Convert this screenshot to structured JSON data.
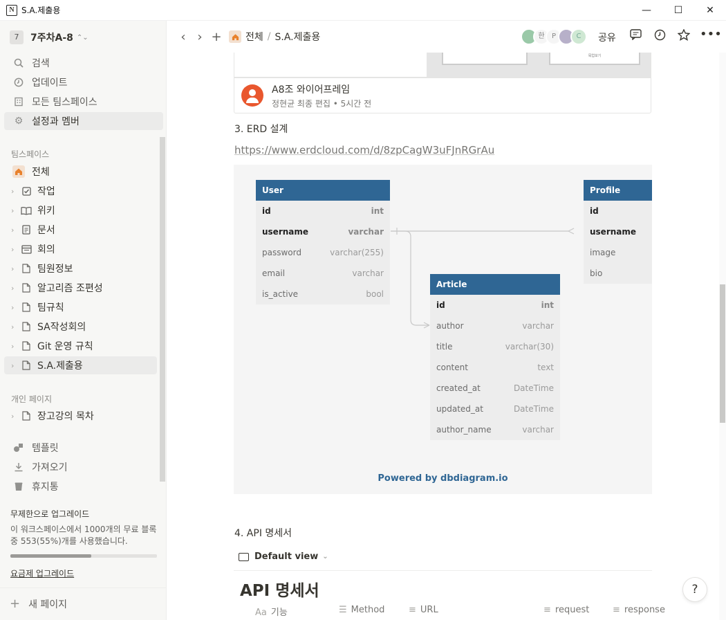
{
  "window": {
    "title": "S.A.제출용",
    "icon": "notion-icon"
  },
  "sidebar": {
    "workspace": {
      "badge": "7",
      "name": "7주차A-8"
    },
    "top_items": [
      {
        "label": "검색",
        "icon": "search-icon"
      },
      {
        "label": "업데이트",
        "icon": "clock-icon"
      },
      {
        "label": "모든 팀스페이스",
        "icon": "building-icon"
      },
      {
        "label": "설정과 멤버",
        "icon": "gear-icon"
      }
    ],
    "teamspace_header": "팀스페이스",
    "teamspace_root": "전체",
    "pages": [
      {
        "label": "작업",
        "icon": "checkbox-icon"
      },
      {
        "label": "위키",
        "icon": "book-icon"
      },
      {
        "label": "문서",
        "icon": "doc-icon"
      },
      {
        "label": "회의",
        "icon": "calendar-icon"
      },
      {
        "label": "팀원정보",
        "icon": "page-icon"
      },
      {
        "label": "알고리즘 조편성",
        "icon": "page-icon"
      },
      {
        "label": "팀규칙",
        "icon": "page-icon"
      },
      {
        "label": "SA작성회의",
        "icon": "page-icon"
      },
      {
        "label": "Git 운영 규칙",
        "icon": "page-icon"
      },
      {
        "label": "S.A.제출용",
        "icon": "page-icon",
        "active": true
      }
    ],
    "private_header": "개인 페이지",
    "private_pages": [
      {
        "label": "장고강의 목차",
        "icon": "page-icon"
      }
    ],
    "bottom_items": [
      {
        "label": "템플릿",
        "icon": "shapes-icon"
      },
      {
        "label": "가져오기",
        "icon": "download-icon"
      },
      {
        "label": "휴지통",
        "icon": "trash-icon"
      }
    ],
    "upgrade": {
      "title": "무제한으로 업그레이드",
      "desc": "이 워크스페이스에서 1000개의 무료 블록 중 553(55%)개를 사용했습니다.",
      "usage_fraction": 0.553,
      "link": "요금제 업그레이드"
    },
    "new_page": "새 페이지"
  },
  "topbar": {
    "breadcrumb": [
      "전체",
      "S.A.제출용"
    ],
    "avatars": [
      "",
      "한",
      "P",
      "",
      "C"
    ],
    "share": "공유"
  },
  "content": {
    "figma_card": {
      "left_text": "",
      "right_text": "목업보기"
    },
    "bookmark": {
      "title": "A8조 와이어프레임",
      "subtitle": "정현균 최종 편집 • 5시간 전"
    },
    "section3": "3. ERD 설계",
    "erd_link": "https://www.erdcloud.com/d/8zpCagW3uFJnRGrAu",
    "erd": {
      "tables": [
        {
          "name": "User",
          "fields": [
            {
              "name": "id",
              "type": "int",
              "pk": true
            },
            {
              "name": "username",
              "type": "varchar",
              "pk": true
            },
            {
              "name": "password",
              "type": "varchar(255)"
            },
            {
              "name": "email",
              "type": "varchar"
            },
            {
              "name": "is_active",
              "type": "bool"
            }
          ]
        },
        {
          "name": "Article",
          "fields": [
            {
              "name": "id",
              "type": "int",
              "pk": true
            },
            {
              "name": "author",
              "type": "varchar"
            },
            {
              "name": "title",
              "type": "varchar(30)"
            },
            {
              "name": "content",
              "type": "text"
            },
            {
              "name": "created_at",
              "type": "DateTime"
            },
            {
              "name": "updated_at",
              "type": "DateTime"
            },
            {
              "name": "author_name",
              "type": "varchar"
            }
          ]
        },
        {
          "name": "Profile",
          "fields": [
            {
              "name": "id",
              "type": "",
              "pk": true
            },
            {
              "name": "username",
              "type": "",
              "pk": true
            },
            {
              "name": "image",
              "type": ""
            },
            {
              "name": "bio",
              "type": ""
            }
          ]
        }
      ],
      "powered_by": "Powered by dbdiagram.io"
    },
    "section4": "4. API 명세서",
    "view_tab": "Default view",
    "db_title": "API 명세서",
    "columns": [
      {
        "icon": "Aa",
        "label": "기능"
      },
      {
        "icon": "☰",
        "label": "Method"
      },
      {
        "icon": "≡",
        "label": "URL"
      },
      {
        "icon": "≡",
        "label": "request"
      },
      {
        "icon": "≡",
        "label": "response"
      }
    ]
  },
  "help_button": "?"
}
